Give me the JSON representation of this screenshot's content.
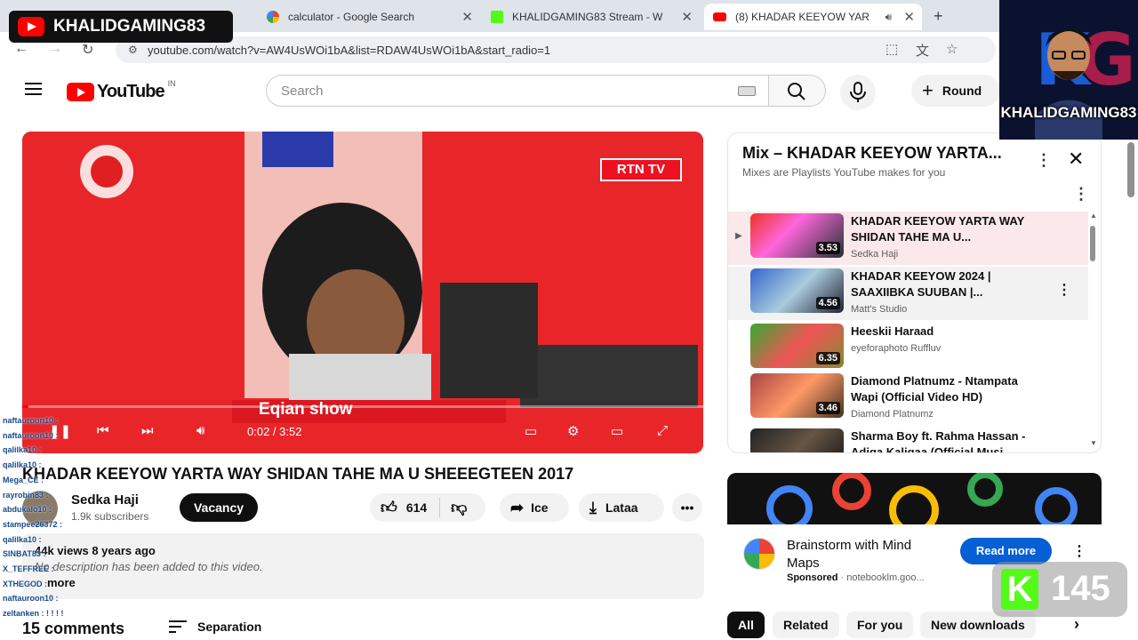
{
  "overlay": {
    "channel_logo_text": "KHALIDGAMING83",
    "avatar_name": "KHALIDGAMING83",
    "kick_count": "145"
  },
  "browser": {
    "tabs": [
      {
        "title": "calculator - Google Search",
        "favicon": "google-icon"
      },
      {
        "title": "KHALIDGAMING83 Stream - W",
        "favicon": "kick-icon"
      },
      {
        "title": "(8) KHADAR KEEYOW YARTA",
        "favicon": "youtube-icon",
        "active": true
      }
    ],
    "new_tab": "+",
    "url": "youtube.com/watch?v=AW4UsWOi1bA&list=RDAW4UsWOi1bA&start_radio=1"
  },
  "header": {
    "logo_text": "YouTube",
    "country_code": "IN",
    "search_placeholder": "Search",
    "create_label": "Round"
  },
  "video": {
    "channel_bug": "RTN TV",
    "caption": "Eqian show",
    "time": "0:02 / 3:52",
    "progress": 0.009
  },
  "watch": {
    "title": "KHADAR KEEYOW YARTA WAY SHIDAN TAHE MA U SHEEEGTEEN 2017",
    "channel": "Sedka Haji",
    "subscribers": "1.9k subscribers",
    "subscribe_label": "Vacancy",
    "likes": "614",
    "share_label": "Ice",
    "download_label": "Lataa",
    "description_meta": "44k views 8 years ago",
    "description_text": "No description has been added to this video.",
    "more_label": "more",
    "comments_count": "15 comments",
    "sort_label": "Separation"
  },
  "chat": [
    "naftauroon10 :",
    "naftauroon10 :",
    "qalilka10 :",
    "qalilka10 :",
    "Mega_CE :",
    "rayrobin83 :",
    "abdukalo10 :",
    "stampee26372 :",
    "qalilka10 :",
    "SINBAT83 :",
    "X_TEFFREE :",
    "XTHEGOD :",
    "naftauroon10 :",
    "zeltanken : ! ! ! !"
  ],
  "playlist": {
    "title": "Mix – KHADAR KEEYOW YARTA...",
    "subtitle": "Mixes are Playlists YouTube makes for you",
    "items": [
      {
        "title": "KHADAR KEEYOW YARTA WAY SHIDAN TAHE MA U...",
        "channel": "Sedka Haji",
        "duration": "3.53"
      },
      {
        "title": "KHADAR KEEYOW 2024 | SAAXIIBKA SUUBAN |...",
        "channel": "Matt's Studio",
        "duration": "4.56"
      },
      {
        "title": "Heeskii Haraad",
        "channel": "eyeforaphoto Ruffluv",
        "duration": "6.35"
      },
      {
        "title": "Diamond Platnumz - Ntampata Wapi (Official Video HD)",
        "channel": "Diamond Platnumz",
        "duration": "3.46"
      },
      {
        "title": "Sharma Boy ft. Rahma Hassan - Adiga Kaligaa (Official Musi...",
        "channel": "",
        "duration": ""
      }
    ]
  },
  "ad": {
    "title": "Brainstorm with Mind Maps",
    "sponsored": "Sponsored",
    "domain": "notebooklm.goo...",
    "cta": "Read more"
  },
  "chips": [
    "All",
    "Related",
    "For you",
    "New downloads"
  ],
  "colors": {
    "accent_red": "#ff0000",
    "link_blue": "#065fd4",
    "kick_green": "#53fc18"
  }
}
